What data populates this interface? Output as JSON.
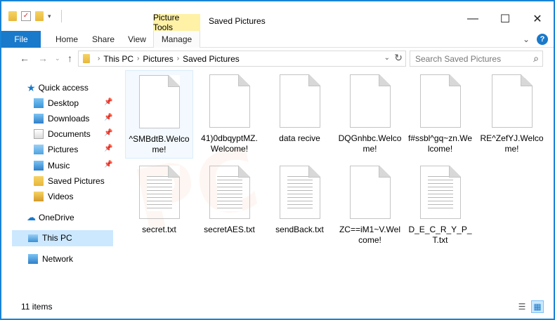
{
  "window": {
    "context_tab": "Picture Tools",
    "title": "Saved Pictures",
    "minimize_glyph": "—",
    "maximize_glyph": "☐",
    "close_glyph": "✕"
  },
  "ribbon": {
    "tabs": [
      {
        "label": "File"
      },
      {
        "label": "Home"
      },
      {
        "label": "Share"
      },
      {
        "label": "View"
      },
      {
        "label": "Manage"
      }
    ]
  },
  "address_bar": {
    "crumbs": [
      "This PC",
      "Pictures",
      "Saved Pictures"
    ],
    "search_placeholder": "Search Saved Pictures"
  },
  "nav_pane": {
    "quick_access": "Quick access",
    "items": [
      {
        "label": "Desktop",
        "pinned": true
      },
      {
        "label": "Downloads",
        "pinned": true
      },
      {
        "label": "Documents",
        "pinned": true
      },
      {
        "label": "Pictures",
        "pinned": true
      },
      {
        "label": "Music",
        "pinned": true
      },
      {
        "label": "Saved Pictures",
        "pinned": false
      },
      {
        "label": "Videos",
        "pinned": false
      }
    ],
    "onedrive": "OneDrive",
    "this_pc": "This PC",
    "network": "Network"
  },
  "files": [
    {
      "name": "^SMBdtB.Welcome!",
      "type": "blank"
    },
    {
      "name": "41)0dbqyptMZ.Welcome!",
      "type": "blank"
    },
    {
      "name": "data recive",
      "type": "blank"
    },
    {
      "name": "DQGnhbc.Welcome!",
      "type": "blank"
    },
    {
      "name": "f#ssbl^gq~zn.Welcome!",
      "type": "blank"
    },
    {
      "name": "RE^ZefYJ.Welcome!",
      "type": "blank"
    },
    {
      "name": "secret.txt",
      "type": "text"
    },
    {
      "name": "secretAES.txt",
      "type": "text"
    },
    {
      "name": "sendBack.txt",
      "type": "text"
    },
    {
      "name": "ZC==iM1~V.Welcome!",
      "type": "blank"
    },
    {
      "name": "D_E_C_R_Y_P_T.txt",
      "type": "text"
    }
  ],
  "status": {
    "item_count": "11 items"
  }
}
